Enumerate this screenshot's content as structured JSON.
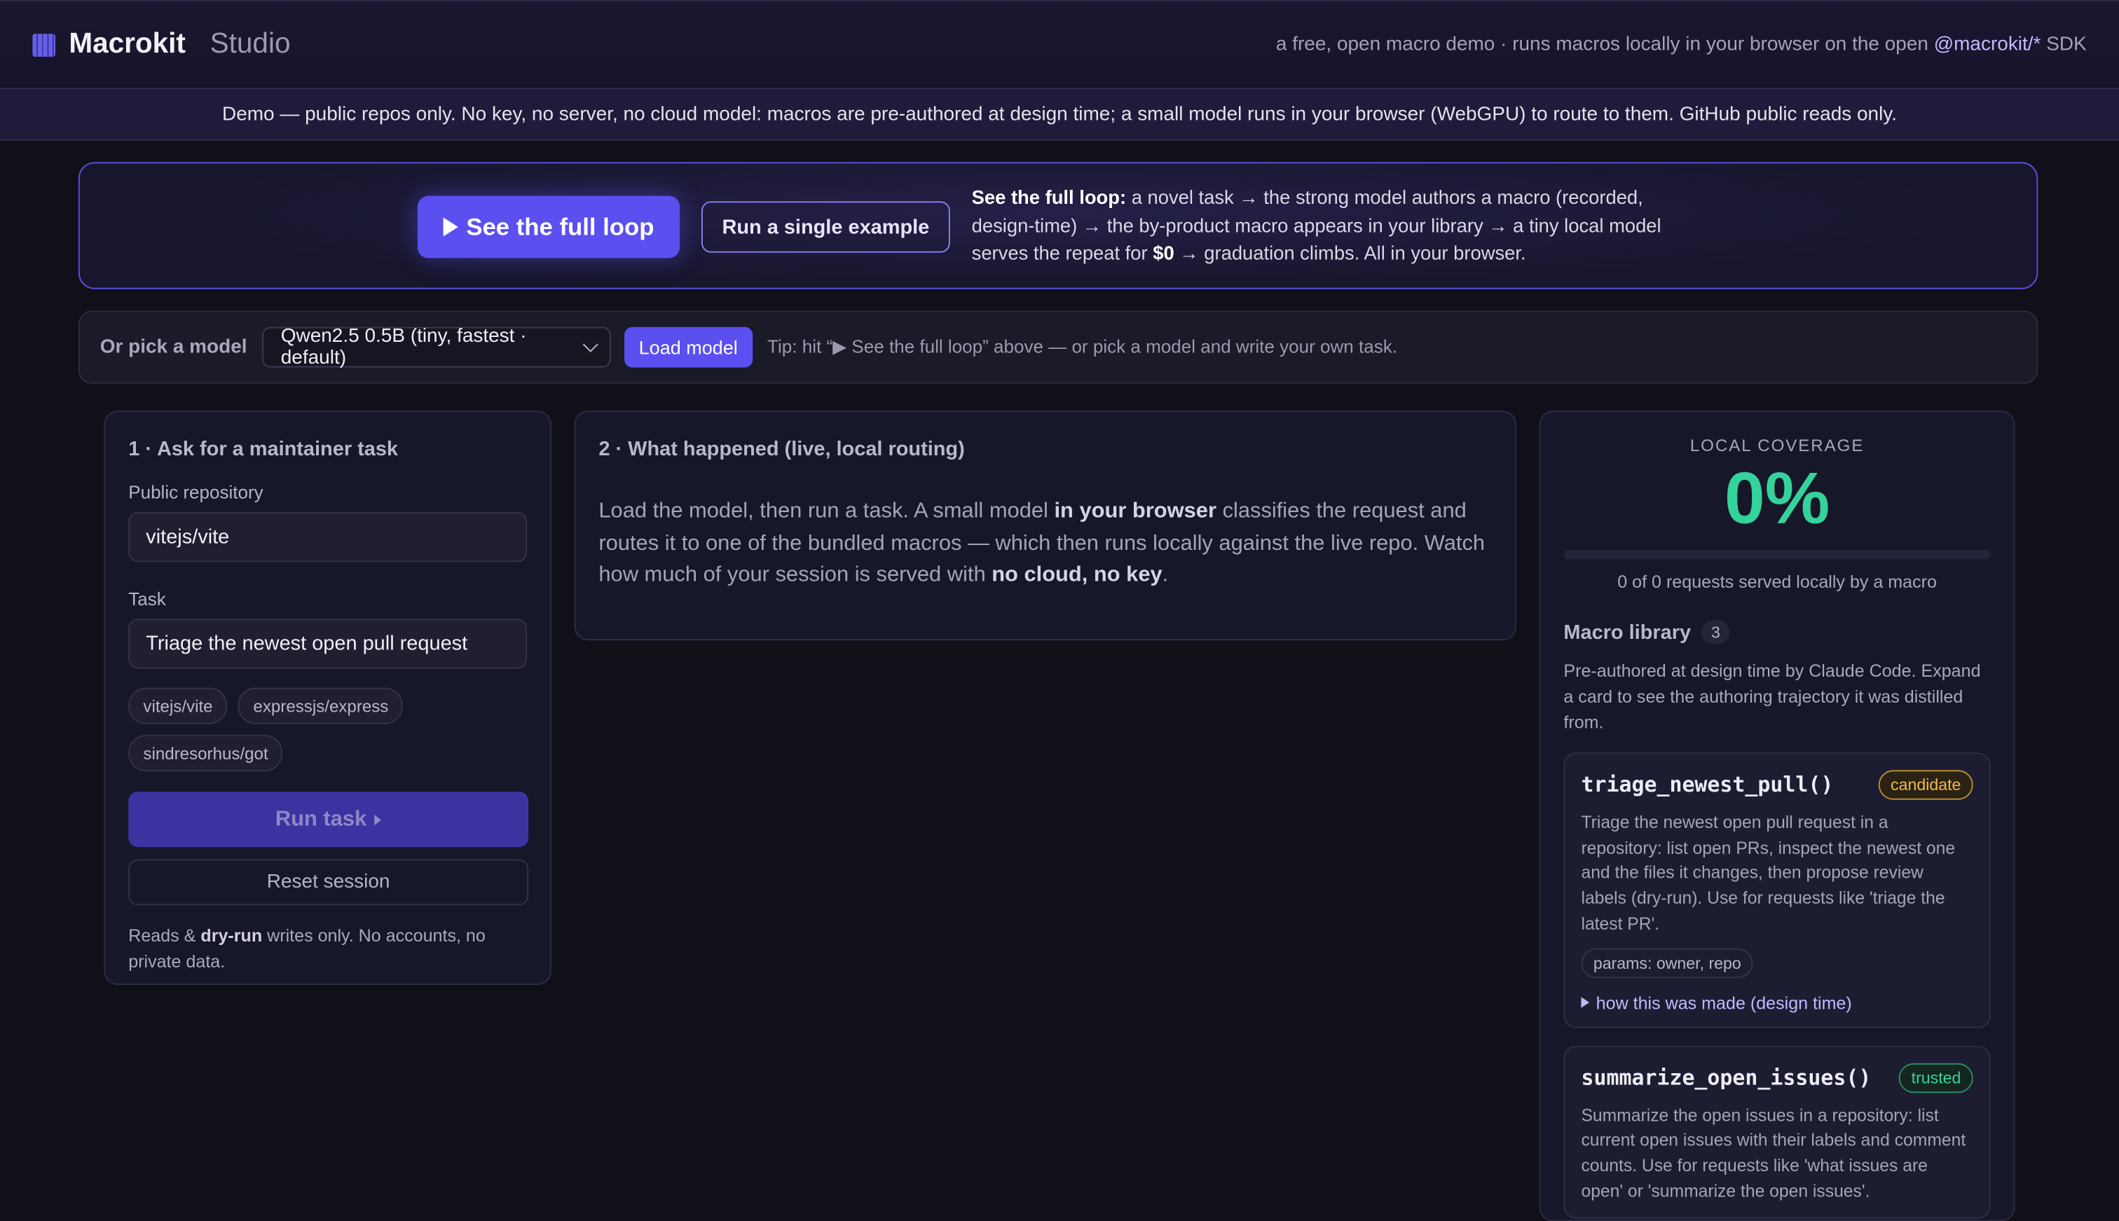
{
  "header": {
    "brand": "Macrokit",
    "brand_suffix": "Studio",
    "tagline_prefix": "a free, open macro demo · runs macros locally in your browser on the open",
    "tagline_sdk": "@macrokit/*",
    "tagline_suffix": "SDK"
  },
  "banner": "Demo — public repos only. No key, no server, no cloud model: macros are pre-authored at design time; a small model runs in your browser (WebGPU) to route to them. GitHub public reads only.",
  "hero": {
    "primary_button": "See the full loop",
    "secondary_button": "Run a single example",
    "text_lead": "See the full loop:",
    "text_a": "a novel task → the strong model authors a macro (recorded, design-time) → the by-product macro appears in your library → a tiny local model serves the repeat for",
    "text_cost": "$0",
    "text_b": "→ graduation climbs. All in your browser."
  },
  "modelbar": {
    "label": "Or pick a model",
    "selected_model": "Qwen2.5 0.5B (tiny, fastest · default)",
    "load_button": "Load model",
    "tip": "Tip: hit “▶ See the full loop” above — or pick a model and write your own task."
  },
  "ask_panel": {
    "title": "1 · Ask for a maintainer task",
    "repo_label": "Public repository",
    "repo_value": "vitejs/vite",
    "task_label": "Task",
    "task_value": "Triage the newest open pull request",
    "repo_chips": [
      "vitejs/vite",
      "expressjs/express",
      "sindresorhus/got"
    ],
    "run_button": "Run task",
    "reset_button": "Reset session",
    "note_a": "Reads &",
    "note_bold": "dry-run",
    "note_b": "writes only. No accounts, no private data."
  },
  "happened_panel": {
    "title": "2 · What happened (live, local routing)",
    "body_a": "Load the model, then run a task. A small model",
    "body_bold1": "in your browser",
    "body_b": "classifies the request and routes it to one of the bundled macros — which then runs locally against the live repo. Watch how much of your session is served with",
    "body_bold2": "no cloud, no key",
    "body_c": "."
  },
  "coverage": {
    "label": "LOCAL COVERAGE",
    "value": "0%",
    "fraction": 0,
    "sub": "0 of 0 requests served locally by a macro"
  },
  "library": {
    "title": "Macro library",
    "count": "3",
    "description": "Pre-authored at design time by Claude Code. Expand a card to see the authoring trajectory it was distilled from.",
    "macros": [
      {
        "name": "triage_newest_pull()",
        "status": "candidate",
        "description": "Triage the newest open pull request in a repository: list open PRs, inspect the newest one and the files it changes, then propose review labels (dry-run). Use for requests like 'triage the latest PR'.",
        "params": "params: owner, repo",
        "howto": "how this was made (design time)"
      },
      {
        "name": "summarize_open_issues()",
        "status": "trusted",
        "description": "Summarize the open issues in a repository: list current open issues with their labels and comment counts. Use for requests like 'what issues are open' or 'summarize the open issues'."
      }
    ]
  },
  "colors": {
    "accent": "#5b4ff0",
    "coverage_green": "#34d39b",
    "candidate_amber": "#f2b94a",
    "background": "#101019"
  }
}
